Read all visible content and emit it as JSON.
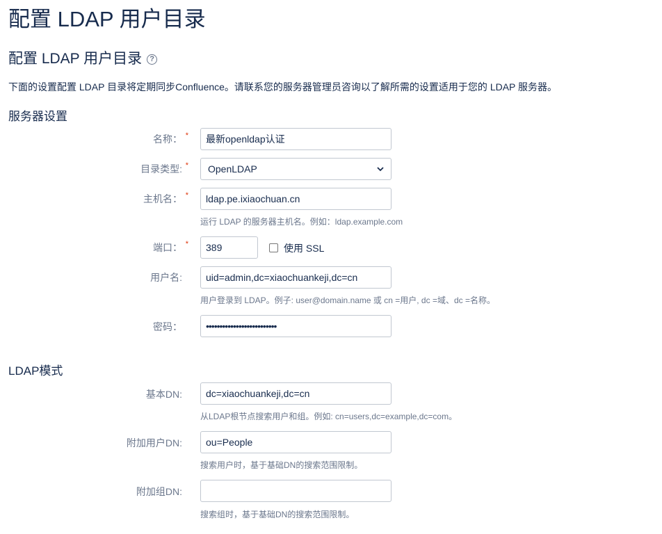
{
  "page": {
    "title": "配置 LDAP 用户目录",
    "subtitle": "配置 LDAP 用户目录",
    "help_icon": "question-circle-icon",
    "intro": "下面的设置配置 LDAP 目录将定期同步Confluence。请联系您的服务器管理员咨询以了解所需的设置适用于您的 LDAP 服务器。"
  },
  "server_settings": {
    "heading": "服务器设置",
    "name": {
      "label": "名称：",
      "required": "*",
      "value": "最新openldap认证"
    },
    "directory_type": {
      "label": "目录类型:",
      "required": "*",
      "value": "OpenLDAP",
      "icon": "chevron-down-icon"
    },
    "hostname": {
      "label": "主机名：",
      "required": "*",
      "value": "ldap.pe.ixiaochuan.cn",
      "description": "运行 LDAP 的服务器主机名。例如：ldap.example.com"
    },
    "port": {
      "label": "端口：",
      "required": "*",
      "value": "389",
      "ssl_label": "使用 SSL",
      "ssl_checked": false
    },
    "username": {
      "label": "用户名:",
      "value": "uid=admin,dc=xiaochuankeji,dc=cn",
      "description": "用户登录到 LDAP。例子: user@domain.name 或 cn =用户, dc =域、dc =名称。"
    },
    "password": {
      "label": "密码：",
      "value": "••••••••••••••••••••••••••"
    }
  },
  "ldap_schema": {
    "heading": "LDAP模式",
    "base_dn": {
      "label": "基本DN:",
      "value": "dc=xiaochuankeji,dc=cn",
      "description": "从LDAP根节点搜索用户和组。例如: cn=users,dc=example,dc=com。"
    },
    "additional_user_dn": {
      "label": "附加用户DN:",
      "value": "ou=People",
      "description": "搜索用户时，基于基础DN的搜索范围限制。"
    },
    "additional_group_dn": {
      "label": "附加组DN:",
      "value": "",
      "description": "搜索组时，基于基础DN的搜索范围限制。"
    }
  }
}
